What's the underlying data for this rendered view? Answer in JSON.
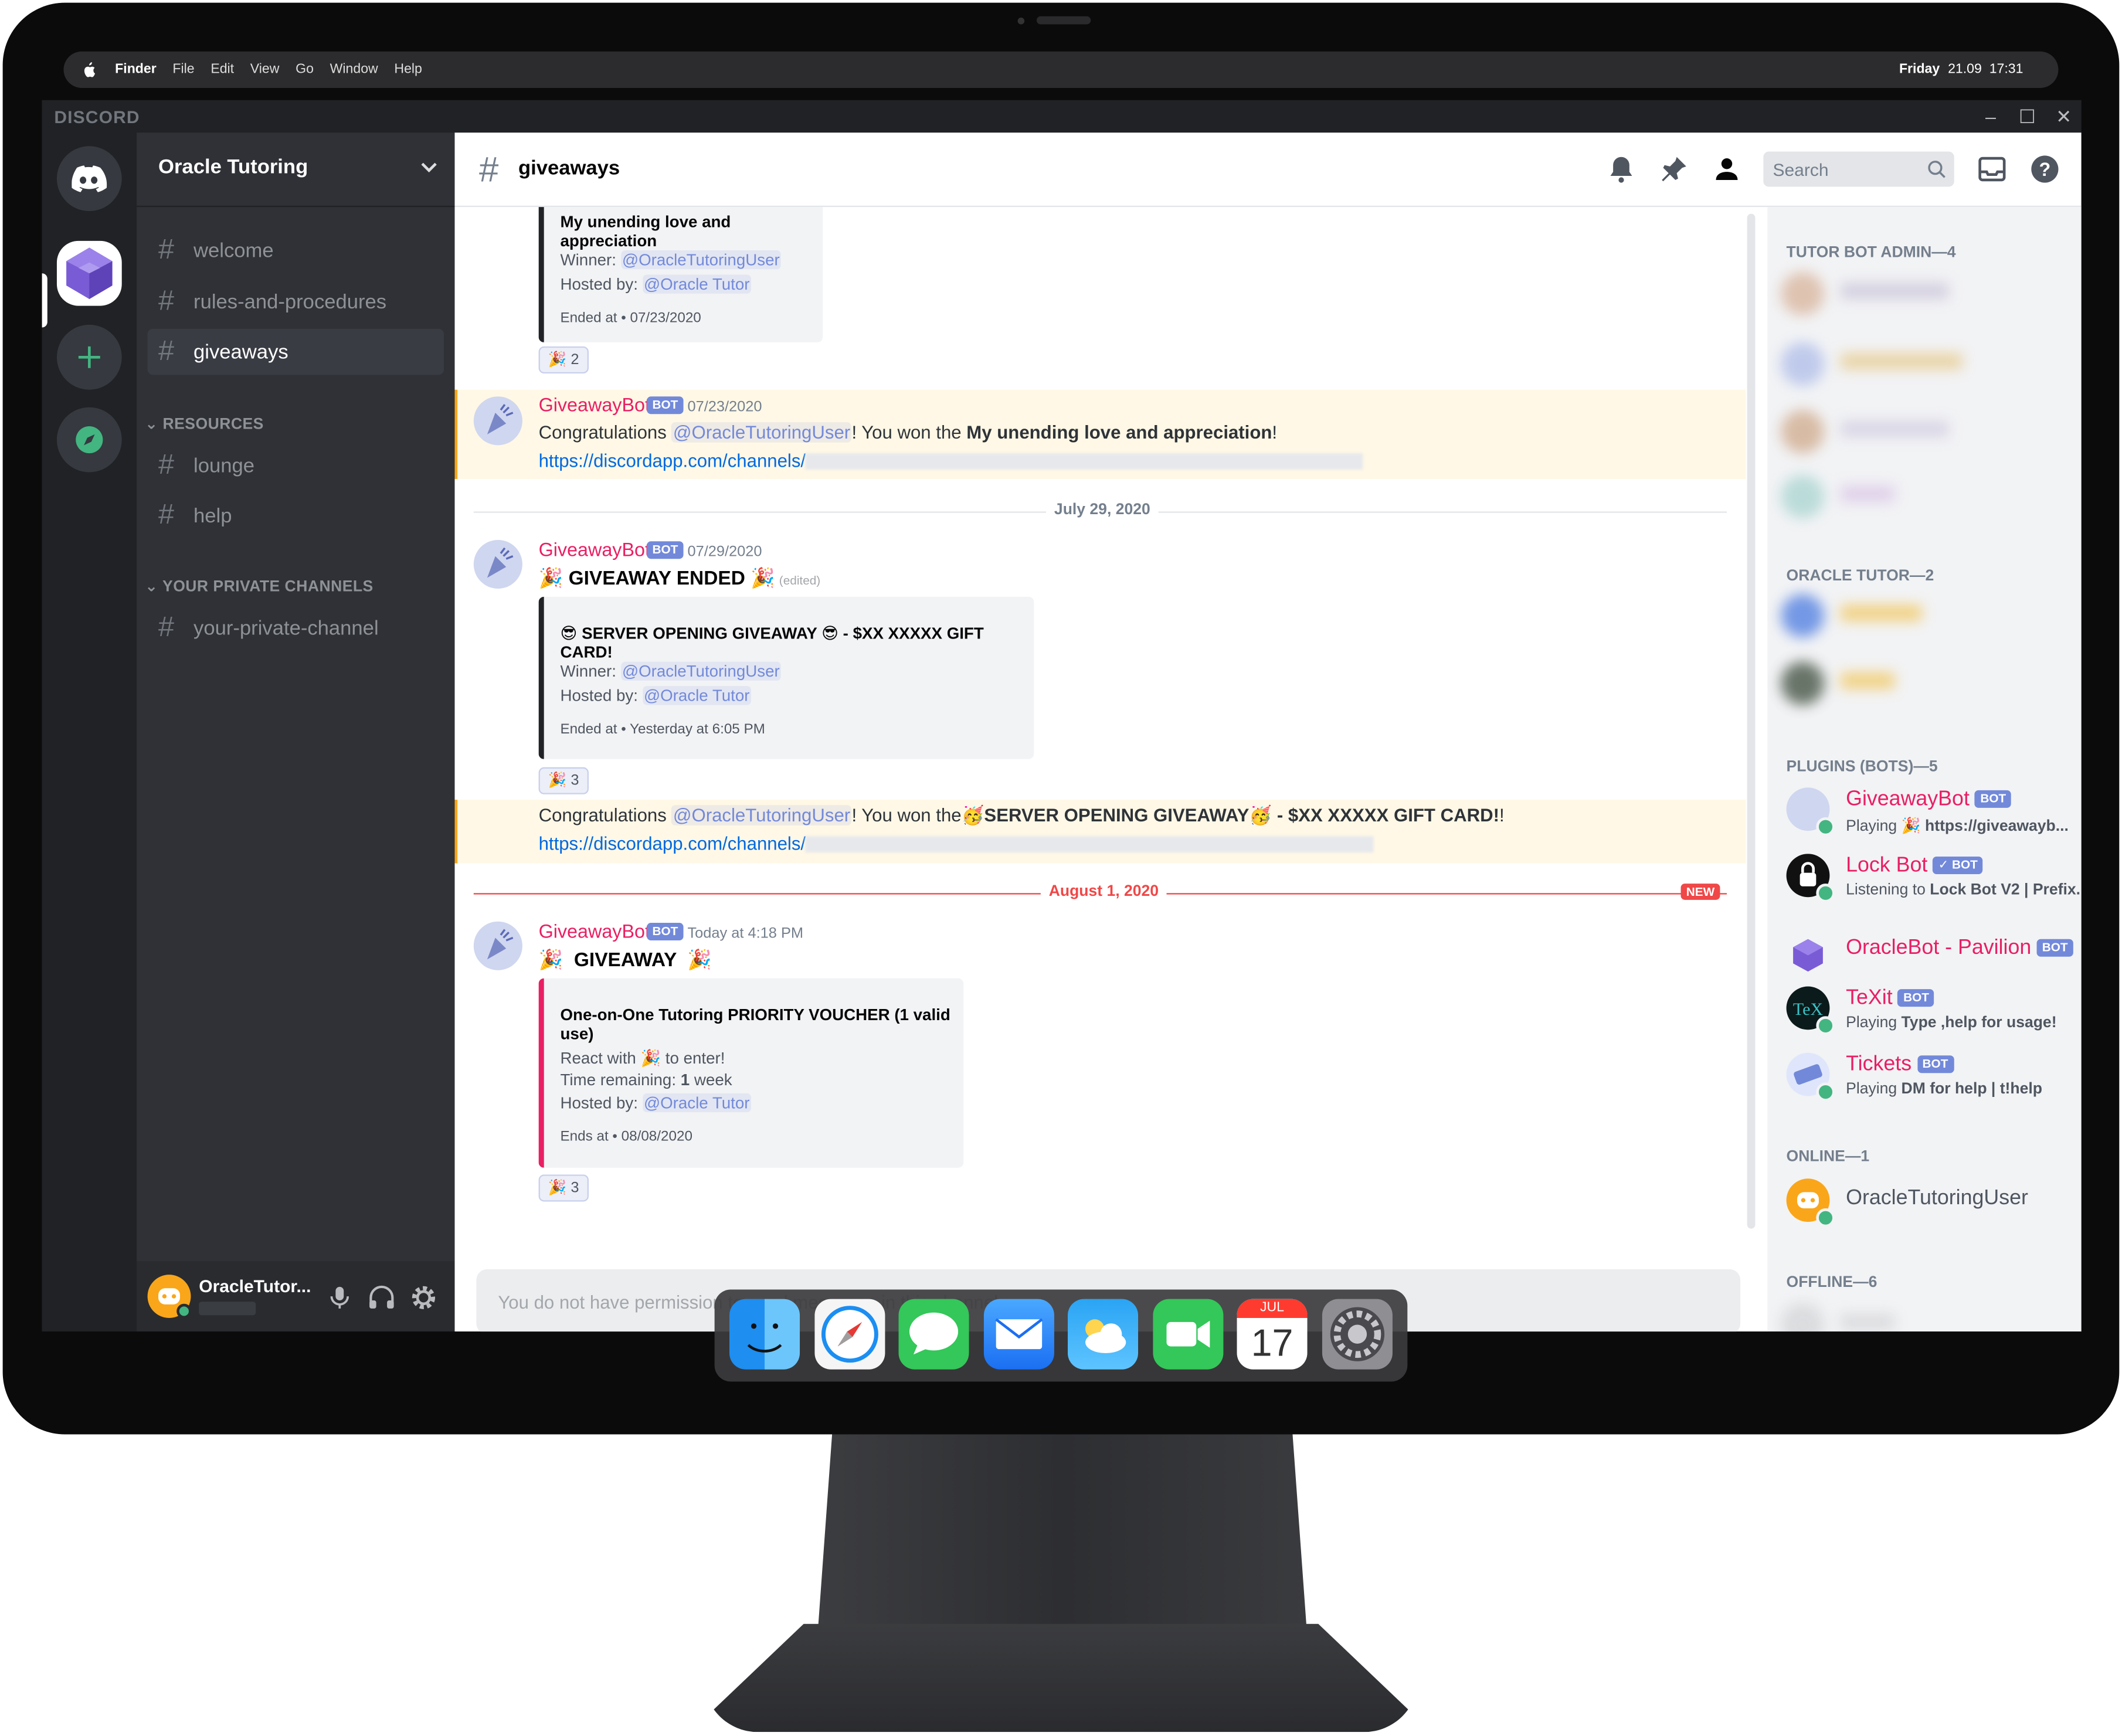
{
  "menubar": {
    "items": [
      "Finder",
      "File",
      "Edit",
      "View",
      "Go",
      "Window",
      "Help"
    ],
    "day": "Friday",
    "date": "21.09",
    "time": "17:31"
  },
  "window": {
    "brand": "DISCORD"
  },
  "server": {
    "name": "Oracle Tutoring",
    "channels_top": [
      "welcome",
      "rules-and-procedures",
      "giveaways"
    ],
    "active_channel": "giveaways",
    "category_resources": "RESOURCES",
    "channels_resources": [
      "lounge",
      "help"
    ],
    "category_private": "YOUR PRIVATE CHANNELS",
    "private_channel": "your-private-channel"
  },
  "user": {
    "name": "OracleTutor..."
  },
  "header": {
    "channel": "giveaways",
    "search_placeholder": "Search"
  },
  "messages": {
    "m0": {
      "embed_title": "My unending love and appreciation",
      "winner_label": "Winner:",
      "winner": "@OracleTutoringUser",
      "host_label": "Hosted by:",
      "host": "@Oracle Tutor",
      "footer": "Ended at • 07/23/2020",
      "reaction_count": "2"
    },
    "m1": {
      "author": "GiveawayBot",
      "bot_tag": "BOT",
      "timestamp": "07/23/2020",
      "text_pre": "Congratulations",
      "mention": "@OracleTutoringUser",
      "text_mid": "! You won the",
      "prize": "My unending love and appreciation",
      "text_post": "!",
      "link": "https://discordapp.com/channels/"
    },
    "divider1": "July 29, 2020",
    "m2": {
      "author": "GiveawayBot",
      "bot_tag": "BOT",
      "timestamp": "07/29/2020",
      "heading": "GIVEAWAY ENDED",
      "edited": "(edited)",
      "embed_title_a": "SERVER OPENING GIVEAWAY",
      "embed_title_b": "- $XX XXXXX GIFT CARD!",
      "winner_label": "Winner:",
      "winner": "@OracleTutoringUser",
      "host_label": "Hosted by:",
      "host": "@Oracle Tutor",
      "footer": "Ended at • Yesterday at 6:05 PM",
      "reaction_count": "3"
    },
    "m3": {
      "text_pre": "Congratulations",
      "mention": "@OracleTutoringUser",
      "text_mid": "! You won the",
      "prize_a": "SERVER OPENING GIVEAWAY",
      "prize_b": "- $XX XXXXX GIFT CARD!",
      "text_post": "!",
      "link": "https://discordapp.com/channels/"
    },
    "divider2": "August 1, 2020",
    "new_tag": "NEW",
    "m4": {
      "author": "GiveawayBot",
      "bot_tag": "BOT",
      "timestamp": "Today at 4:18 PM",
      "heading": "GIVEAWAY",
      "embed_title": "One-on-One Tutoring PRIORITY VOUCHER (1 valid use)",
      "react_pre": "React with",
      "react_post": "to enter!",
      "time_label": "Time remaining:",
      "time_value": "1",
      "time_unit": "week",
      "host_label": "Hosted by:",
      "host": "@Oracle Tutor",
      "footer": "Ends at • 08/08/2020",
      "reaction_count": "3"
    },
    "input_placeholder": "You do not have permission to send messages in this channel."
  },
  "members": {
    "cat_admin": "TUTOR BOT ADMIN—4",
    "cat_tutor": "ORACLE TUTOR—2",
    "cat_plugins": "PLUGINS (BOTS)—5",
    "bots": [
      {
        "name": "GiveawayBot",
        "tag": "BOT",
        "sub_pre": "Playing",
        "sub_bold": "https://giveawayb..."
      },
      {
        "name": "Lock Bot",
        "tag": "✓ BOT",
        "sub_pre": "Listening to",
        "sub_bold": "Lock Bot V2 | Prefix."
      },
      {
        "name": "OracleBot - Pavilion",
        "tag": "BOT",
        "sub_pre": "",
        "sub_bold": ""
      },
      {
        "name": "TeXit",
        "tag": "BOT",
        "sub_pre": "Playing",
        "sub_bold": "Type ,help for usage!"
      },
      {
        "name": "Tickets",
        "tag": "BOT",
        "sub_pre": "Playing",
        "sub_bold": "DM for help | t!help"
      }
    ],
    "cat_online": "ONLINE—1",
    "online_user": "OracleTutoringUser",
    "cat_offline": "OFFLINE—6"
  },
  "dock": {
    "apps": [
      "finder-icon",
      "safari-icon",
      "messages-icon",
      "mail-icon",
      "weather-icon",
      "facetime-icon",
      "calendar-icon",
      "settings-icon"
    ],
    "calendar_month": "JUL",
    "calendar_day": "17"
  },
  "colors": {
    "blurple": "#7289da",
    "bot_name": "#e91e63",
    "highlight_bg": "#fff8e6",
    "highlight_bar": "#faa61a",
    "new_red": "#f04747",
    "online": "#43b581"
  }
}
